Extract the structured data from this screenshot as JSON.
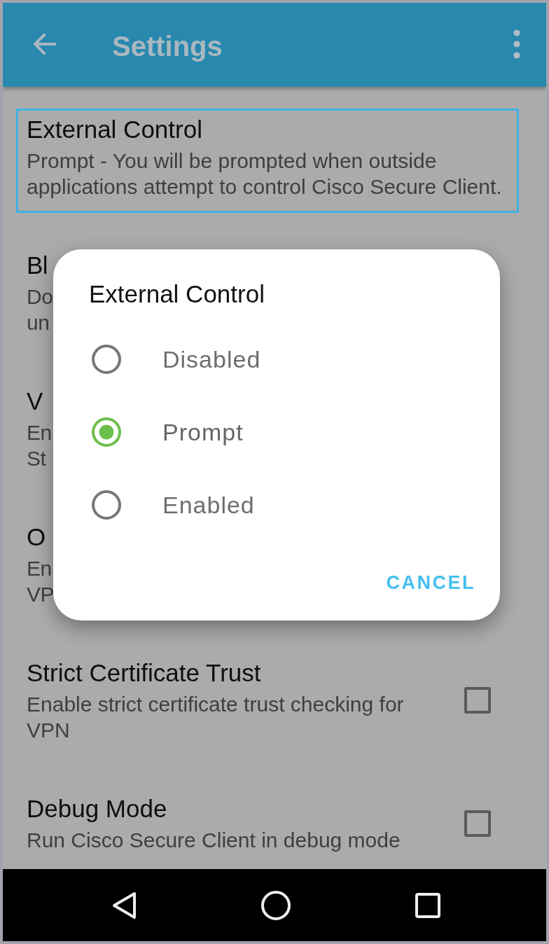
{
  "app_bar": {
    "title": "Settings"
  },
  "settings": [
    {
      "kind": "text",
      "title": "External Control",
      "description": "Prompt - You will be prompted when outside applications attempt to control Cisco Secure Client.",
      "selected": true
    },
    {
      "kind": "covered",
      "title": "Bl",
      "description_fragments": [
        "Do",
        "un"
      ],
      "selected": false
    },
    {
      "kind": "covered",
      "title": "V",
      "description_fragments": [
        "En",
        "St"
      ],
      "selected": false
    },
    {
      "kind": "covered",
      "title": "O",
      "description_fragments": [
        "En",
        "VP"
      ],
      "selected": false
    },
    {
      "kind": "checkbox",
      "title": "Strict Certificate Trust",
      "description": "Enable strict certificate trust checking for VPN",
      "checked": false,
      "selected": false
    },
    {
      "kind": "checkbox",
      "title": "Debug Mode",
      "description": "Run Cisco Secure Client in debug mode",
      "checked": false,
      "selected": false
    }
  ],
  "dialog": {
    "title": "External Control",
    "options": [
      {
        "label": "Disabled",
        "selected": false
      },
      {
        "label": "Prompt",
        "selected": true
      },
      {
        "label": "Enabled",
        "selected": false
      }
    ],
    "button": "CANCEL"
  }
}
